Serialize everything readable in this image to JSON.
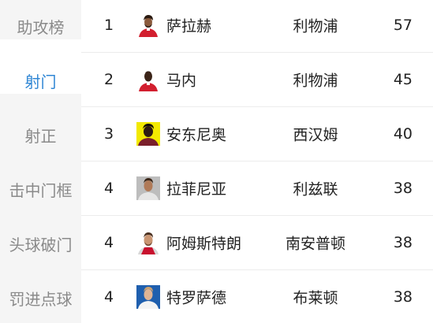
{
  "sidebar": {
    "items": [
      {
        "label": "助攻榜",
        "active": false
      },
      {
        "label": "射门",
        "active": true
      },
      {
        "label": "射正",
        "active": false
      },
      {
        "label": "击中门框",
        "active": false
      },
      {
        "label": "头球破门",
        "active": false
      },
      {
        "label": "罚进点球",
        "active": false
      }
    ],
    "active_color": "#2f86d4"
  },
  "rows": [
    {
      "rank": "1",
      "player": "萨拉赫",
      "team": "利物浦",
      "value": "57",
      "avatar": "player-avatar-red-kit"
    },
    {
      "rank": "2",
      "player": "马内",
      "team": "利物浦",
      "value": "45",
      "avatar": "player-avatar-red-kit"
    },
    {
      "rank": "3",
      "player": "安东尼奥",
      "team": "西汉姆",
      "value": "40",
      "avatar": "player-avatar-yellow-bg"
    },
    {
      "rank": "4",
      "player": "拉菲尼亚",
      "team": "利兹联",
      "value": "38",
      "avatar": "player-avatar-grey"
    },
    {
      "rank": "4",
      "player": "阿姆斯特朗",
      "team": "南安普顿",
      "value": "38",
      "avatar": "player-avatar-red-white"
    },
    {
      "rank": "4",
      "player": "特罗萨德",
      "team": "布莱顿",
      "value": "38",
      "avatar": "player-avatar-blue"
    }
  ]
}
